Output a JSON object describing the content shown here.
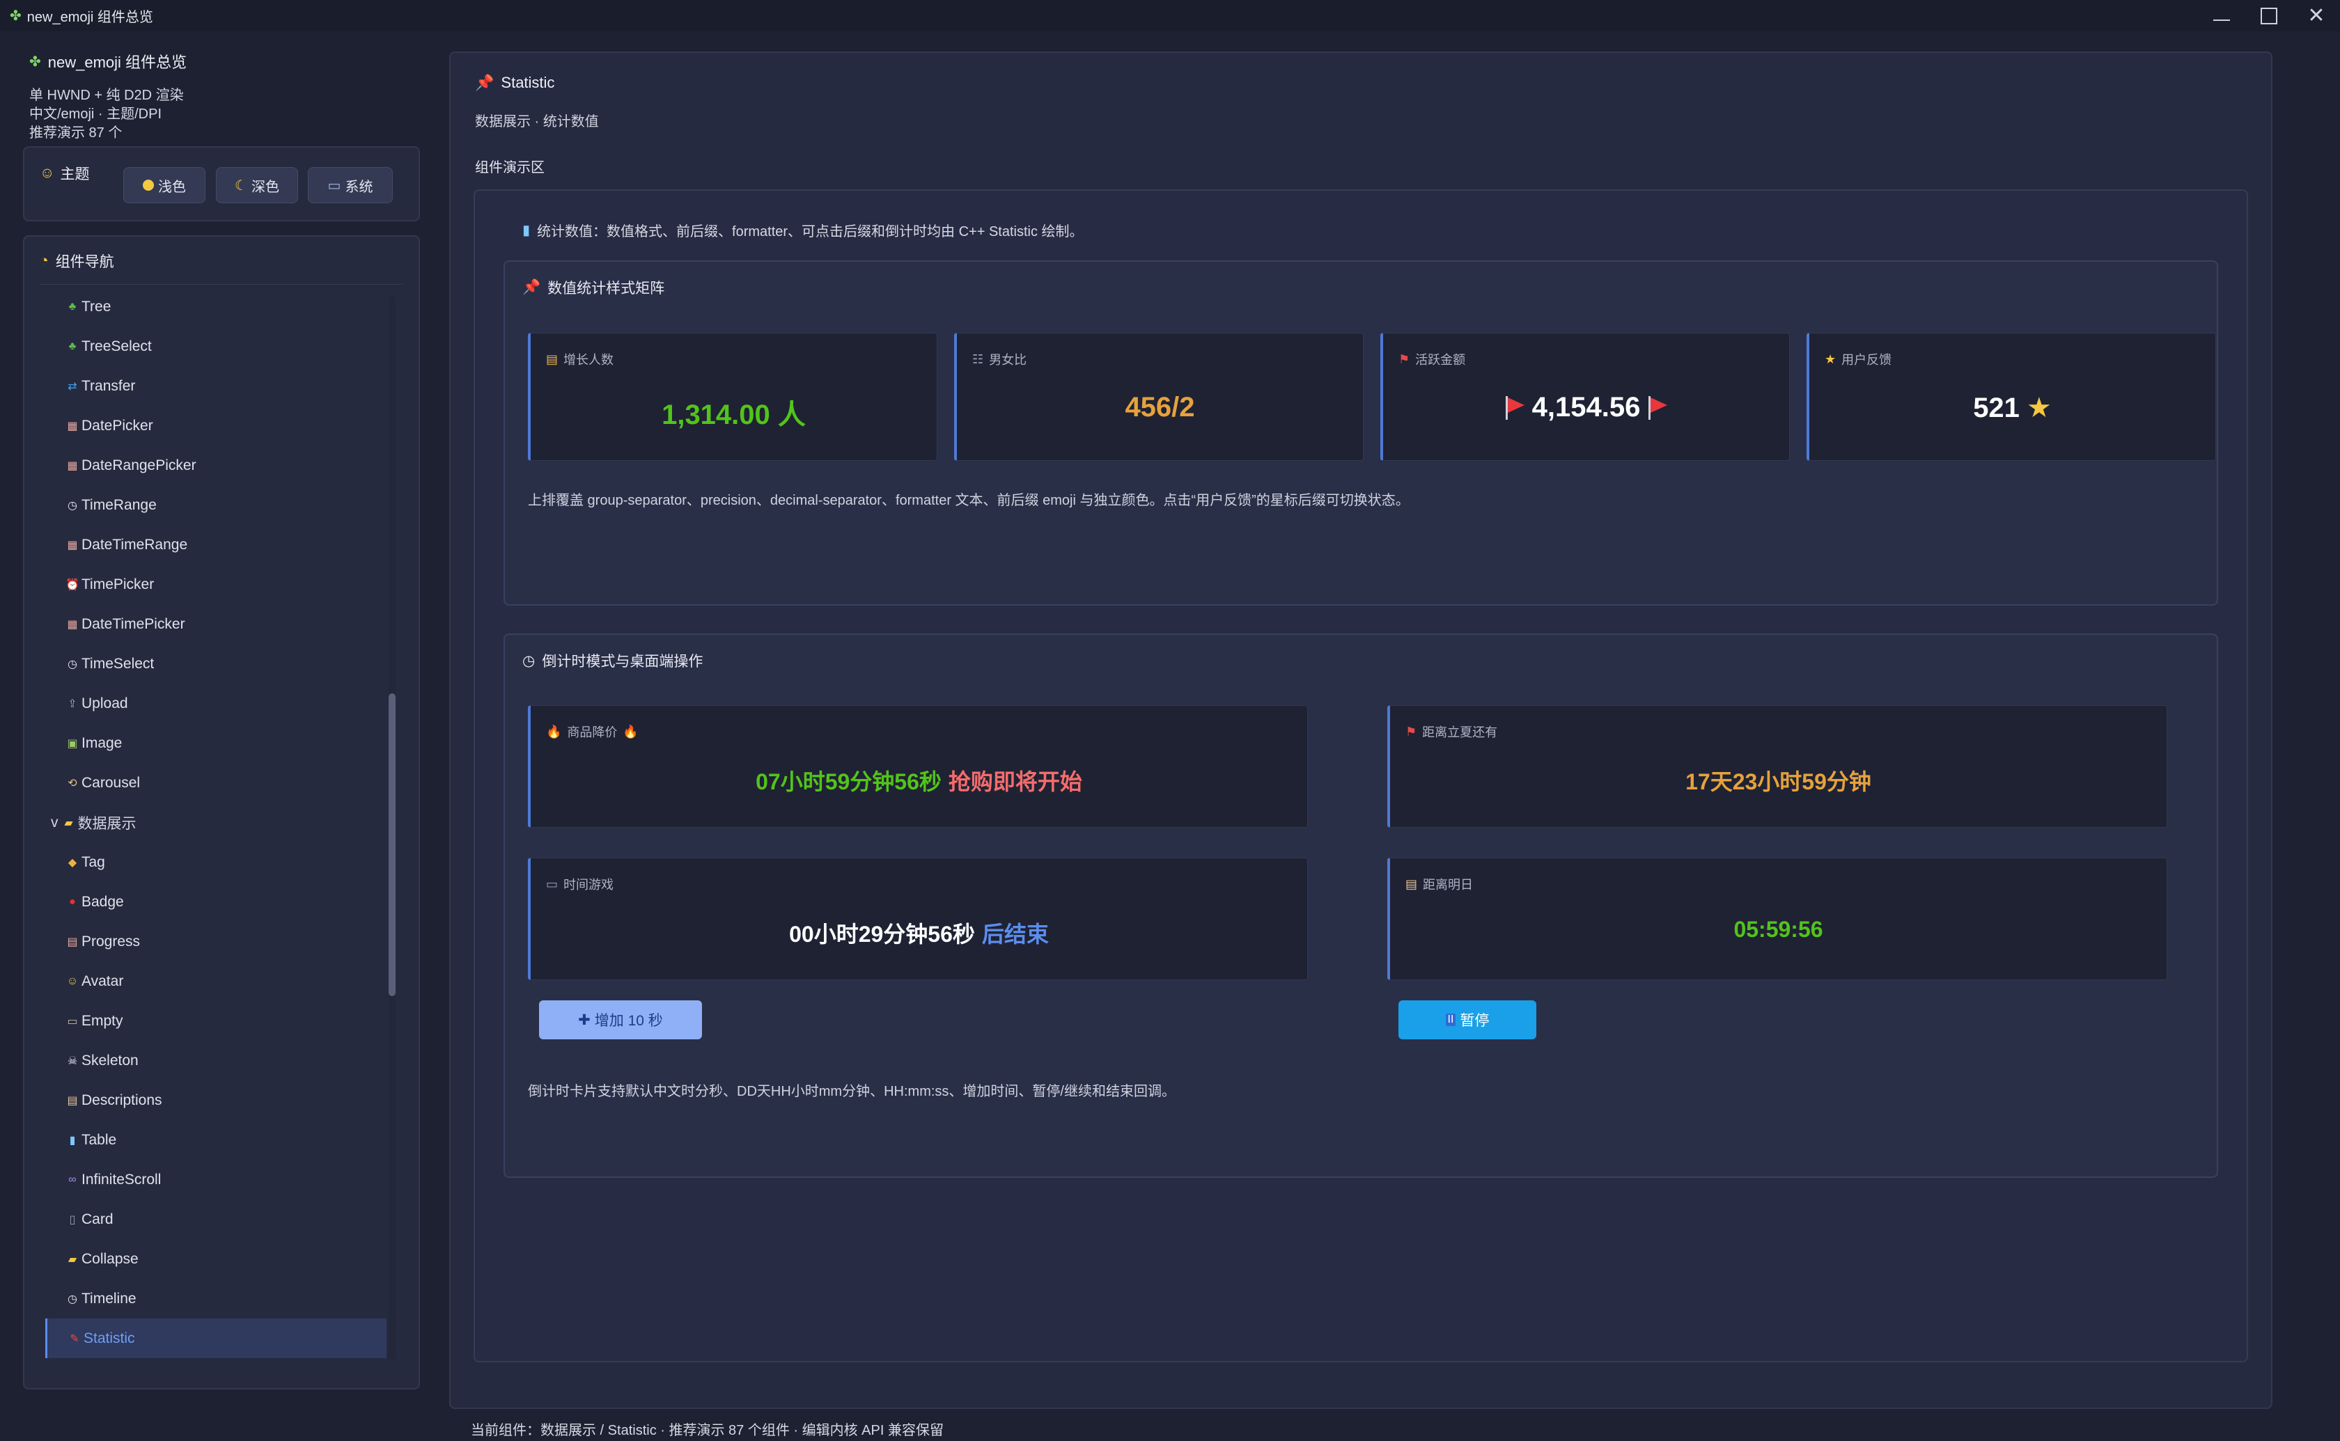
{
  "window": {
    "title": "new_emoji 组件总览"
  },
  "sidebar": {
    "header": "new_emoji 组件总览",
    "info": [
      "单 HWND + 纯 D2D 渲染",
      "中文/emoji · 主题/DPI",
      "推荐演示 87 个"
    ],
    "theme": {
      "label": "主题",
      "light": "浅色",
      "dark": "深色",
      "system": "系统"
    },
    "nav_title": "组件导航",
    "items": [
      {
        "label": "Tree",
        "icon": "tree-icon"
      },
      {
        "label": "TreeSelect",
        "icon": "tree-icon"
      },
      {
        "label": "Transfer",
        "icon": "transfer-icon"
      },
      {
        "label": "DatePicker",
        "icon": "calendar-icon"
      },
      {
        "label": "DateRangePicker",
        "icon": "calendar-icon"
      },
      {
        "label": "TimeRange",
        "icon": "clock-icon"
      },
      {
        "label": "DateTimeRange",
        "icon": "calendar-icon"
      },
      {
        "label": "TimePicker",
        "icon": "alarm-clock-icon"
      },
      {
        "label": "DateTimePicker",
        "icon": "calendar-icon"
      },
      {
        "label": "TimeSelect",
        "icon": "clock-icon"
      },
      {
        "label": "Upload",
        "icon": "upload-icon"
      },
      {
        "label": "Image",
        "icon": "picture-icon"
      },
      {
        "label": "Carousel",
        "icon": "carousel-icon"
      },
      {
        "label": "数据展示",
        "icon": "folder-icon",
        "group": true,
        "prefix": "v"
      },
      {
        "label": "Tag",
        "icon": "tag-icon"
      },
      {
        "label": "Badge",
        "icon": "red-dot-icon"
      },
      {
        "label": "Progress",
        "icon": "chart-icon"
      },
      {
        "label": "Avatar",
        "icon": "smiley-icon"
      },
      {
        "label": "Empty",
        "icon": "empty-icon"
      },
      {
        "label": "Skeleton",
        "icon": "skull-icon"
      },
      {
        "label": "Descriptions",
        "icon": "document-icon"
      },
      {
        "label": "Table",
        "icon": "bar-chart-icon"
      },
      {
        "label": "InfiniteScroll",
        "icon": "infinity-icon"
      },
      {
        "label": "Card",
        "icon": "card-icon"
      },
      {
        "label": "Collapse",
        "icon": "folder-icon"
      },
      {
        "label": "Timeline",
        "icon": "clock-icon"
      },
      {
        "label": "Statistic",
        "icon": "pin-icon",
        "active": true
      }
    ]
  },
  "main": {
    "title": "Statistic",
    "subtitle": "数据展示 · 统计数值",
    "demo_label": "组件演示区",
    "description": "统计数值：数值格式、前后缀、formatter、可点击后缀和倒计时均由 C++ Statistic 绘制。",
    "section1": {
      "title": "数值统计样式矩阵",
      "cards": [
        {
          "label": "增长人数",
          "value": "1,314.00 人",
          "color": "#52c41a",
          "icon": "chart-up-icon"
        },
        {
          "label": "男女比",
          "value": "456/2",
          "color": "#e6a23c",
          "icon": "people-icon"
        },
        {
          "label": "活跃金额",
          "value": "4,154.56",
          "color": "#ffffff",
          "icon": "flag-icon"
        },
        {
          "label": "用户反馈",
          "value": "521",
          "suffix": "★",
          "color": "#ffffff",
          "icon": "star-icon"
        }
      ],
      "note": "上排覆盖 group-separator、precision、decimal-separator、formatter 文本、前后缀 emoji 与独立颜色。点击“用户反馈”的星标后缀可切换状态。"
    },
    "section2": {
      "title": "倒计时模式与桌面端操作",
      "cards": [
        {
          "label": "商品降价",
          "value": "07小时59分钟56秒",
          "suffix": "抢购即将开始",
          "color": "#52c41a",
          "suffix_color": "#f56c6c"
        },
        {
          "label": "距离立夏还有",
          "value": "17天23小时59分钟",
          "color": "#e6a23c"
        },
        {
          "label": "时间游戏",
          "value": "00小时29分钟56秒",
          "suffix": "后结束",
          "color": "#ffffff",
          "suffix_color": "#5b8def"
        },
        {
          "label": "距离明日",
          "value": "05:59:56",
          "color": "#52c41a"
        }
      ],
      "add_button": "增加 10 秒",
      "pause_button": "暂停",
      "note": "倒计时卡片支持默认中文时分秒、DD天HH小时mm分钟、HH:mm:ss、增加时间、暂停/继续和结束回调。"
    }
  },
  "statusbar": "当前组件：数据展示 / Statistic · 推荐演示 87 个组件 · 编辑内核 API 兼容保留"
}
